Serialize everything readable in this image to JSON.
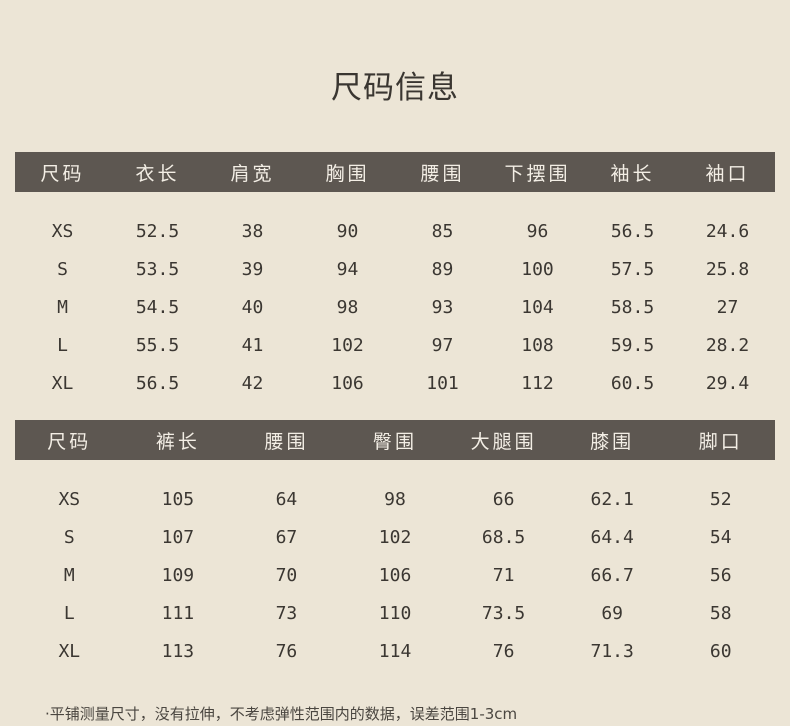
{
  "title": "尺码信息",
  "tops": {
    "headers": [
      "尺码",
      "衣长",
      "肩宽",
      "胸围",
      "腰围",
      "下摆围",
      "袖长",
      "袖口"
    ],
    "rows": [
      [
        "XS",
        "52.5",
        "38",
        "90",
        "85",
        "96",
        "56.5",
        "24.6"
      ],
      [
        "S",
        "53.5",
        "39",
        "94",
        "89",
        "100",
        "57.5",
        "25.8"
      ],
      [
        "M",
        "54.5",
        "40",
        "98",
        "93",
        "104",
        "58.5",
        "27"
      ],
      [
        "L",
        "55.5",
        "41",
        "102",
        "97",
        "108",
        "59.5",
        "28.2"
      ],
      [
        "XL",
        "56.5",
        "42",
        "106",
        "101",
        "112",
        "60.5",
        "29.4"
      ]
    ]
  },
  "bottoms": {
    "headers": [
      "尺码",
      "裤长",
      "腰围",
      "臀围",
      "大腿围",
      "膝围",
      "脚口"
    ],
    "rows": [
      [
        "XS",
        "105",
        "64",
        "98",
        "66",
        "62.1",
        "52"
      ],
      [
        "S",
        "107",
        "67",
        "102",
        "68.5",
        "64.4",
        "54"
      ],
      [
        "M",
        "109",
        "70",
        "106",
        "71",
        "66.7",
        "56"
      ],
      [
        "L",
        "111",
        "73",
        "110",
        "73.5",
        "69",
        "58"
      ],
      [
        "XL",
        "113",
        "76",
        "114",
        "76",
        "71.3",
        "60"
      ]
    ]
  },
  "footnote": "·平铺测量尺寸，没有拉伸，不考虑弹性范围内的数据，误差范围1-3cm",
  "colors": {
    "background": "#ece5d6",
    "header_bar": "#5d5751",
    "header_text": "#f3eee5",
    "body_text": "#3b3732"
  }
}
